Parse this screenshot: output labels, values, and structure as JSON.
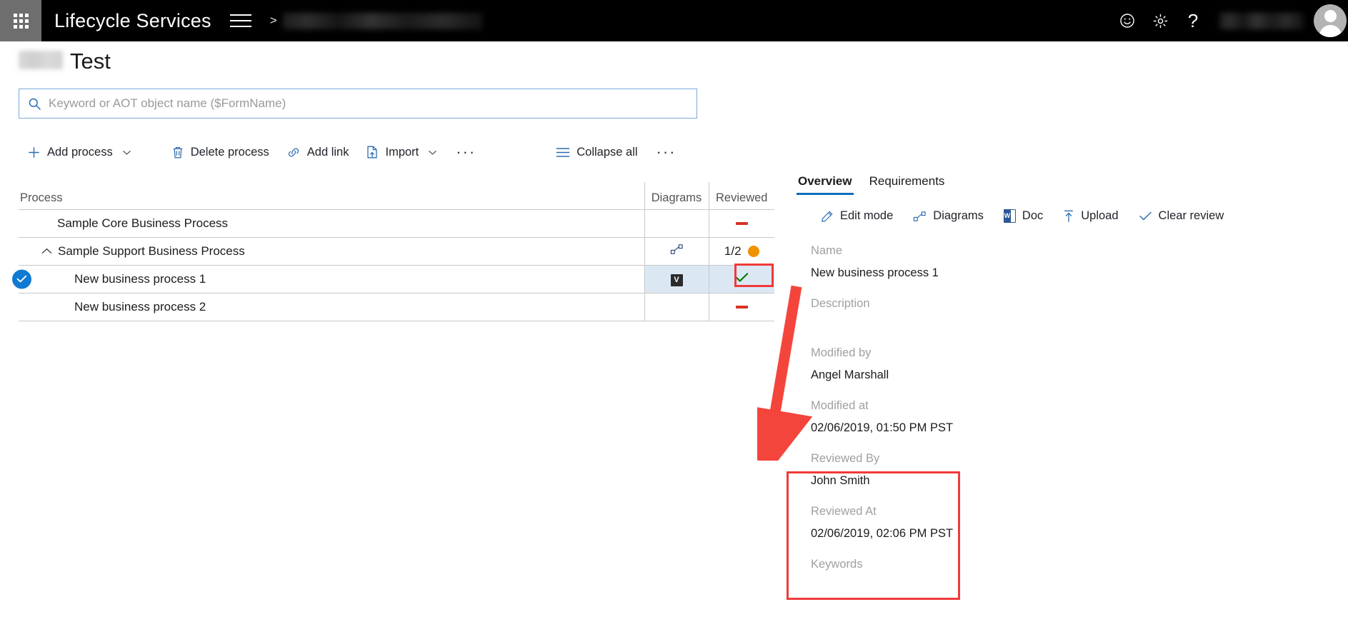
{
  "topbar": {
    "waffle_label": "app-launcher",
    "brand": "Lifecycle Services",
    "breadcrumb_separator": ">",
    "breadcrumb_redacted": true,
    "user_name_redacted": true,
    "icons": [
      "smiley-icon",
      "gear-icon",
      "help-icon",
      "avatar"
    ]
  },
  "page": {
    "title": "Test",
    "title_prefix_redacted": true
  },
  "search": {
    "placeholder": "Keyword or AOT object name ($FormName)",
    "value": "",
    "icon": "search-icon"
  },
  "toolbar": {
    "items": [
      {
        "label": "Add process",
        "icon": "plus-icon",
        "has_chevron": true
      },
      {
        "label": "Delete process",
        "icon": "trash-icon",
        "has_chevron": false
      },
      {
        "label": "Add link",
        "icon": "link-icon",
        "has_chevron": false
      },
      {
        "label": "Import",
        "icon": "import-icon",
        "has_chevron": true
      }
    ],
    "overflow_label": "···",
    "collapse_all": {
      "label": "Collapse all",
      "icon": "list-icon"
    },
    "overflow2_label": "···"
  },
  "table": {
    "columns": [
      "Process",
      "Diagrams",
      "Reviewed"
    ],
    "rows": [
      {
        "name": "Sample Core Business Process",
        "indent": 1,
        "expandable": false,
        "selected": false,
        "diagram_icon": "",
        "reviewed_type": "none",
        "reviewed_text": ""
      },
      {
        "name": "Sample Support Business Process",
        "indent": 0,
        "expandable": true,
        "chevron": "chevron-up-icon",
        "selected": false,
        "diagram_icon": "diagram-icon",
        "reviewed_type": "partial",
        "reviewed_text": "1/2"
      },
      {
        "name": "New business process 1",
        "indent": 2,
        "expandable": false,
        "selected": true,
        "diagram_icon": "visio-icon",
        "diagram_icon_text": "V",
        "reviewed_type": "checked",
        "reviewed_text": ""
      },
      {
        "name": "New business process 2",
        "indent": 2,
        "expandable": false,
        "selected": false,
        "diagram_icon": "",
        "reviewed_type": "none",
        "reviewed_text": ""
      }
    ]
  },
  "details": {
    "tabs": [
      {
        "label": "Overview",
        "active": true
      },
      {
        "label": "Requirements",
        "active": false
      }
    ],
    "commands": [
      {
        "label": "Edit mode",
        "icon": "pencil-icon"
      },
      {
        "label": "Diagrams",
        "icon": "diagram-icon"
      },
      {
        "label": "Doc",
        "icon": "word-doc-icon"
      },
      {
        "label": "Upload",
        "icon": "upload-icon"
      },
      {
        "label": "Clear review",
        "icon": "check-icon"
      }
    ],
    "fields": [
      {
        "label": "Name",
        "value": "New business process 1"
      },
      {
        "label": "Description",
        "value": ""
      },
      {
        "label": "Modified by",
        "value": "Angel Marshall"
      },
      {
        "label": "Modified at",
        "value": "02/06/2019, 01:50 PM PST"
      },
      {
        "label": "Reviewed By",
        "value": "John Smith"
      },
      {
        "label": "Reviewed At",
        "value": "02/06/2019, 02:06 PM PST"
      },
      {
        "label": "Keywords",
        "value": ""
      }
    ]
  },
  "annotations": {
    "highlight_color": "#f03a3a",
    "arrow_color": "#f4453c",
    "boxes": [
      "reviewed-cell-highlight",
      "reviewed-by-block-highlight"
    ],
    "arrow": "points from reviewed checkmark cell to modified-at value"
  },
  "colors": {
    "accent": "#0f6cbd",
    "brand_bar": "#000000",
    "selected_row": "#dbe8f4",
    "status_green": "#107c10",
    "status_orange": "#f29100",
    "status_red": "#d93025"
  }
}
